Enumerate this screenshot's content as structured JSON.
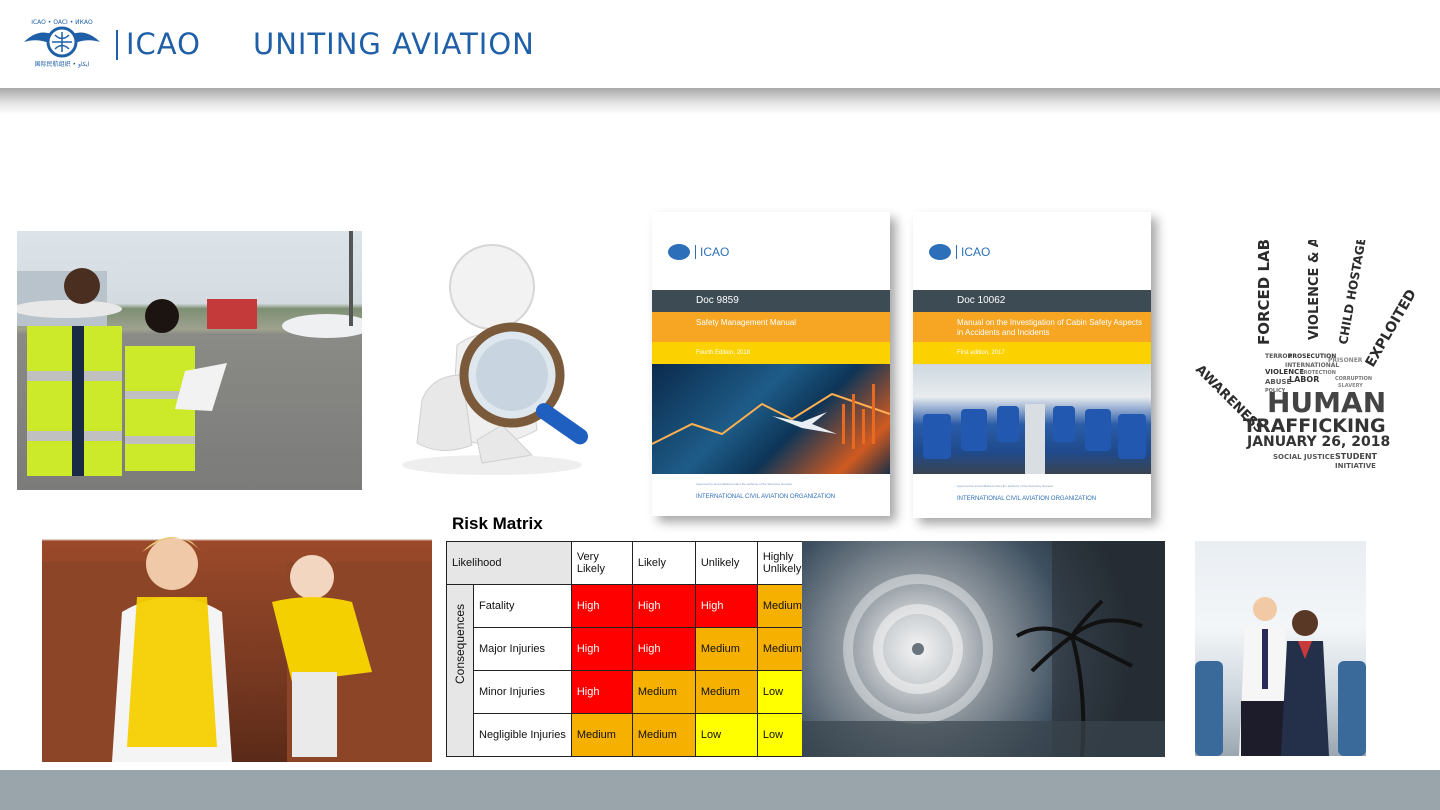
{
  "header": {
    "brand": "ICAO",
    "tagline": "UNITING AVIATION"
  },
  "colors": {
    "brand_blue": "#1f5fa8",
    "risk_high": "#ff0000",
    "risk_medium": "#f6b000",
    "risk_low": "#ffff00",
    "footer": "#9aa5ab"
  },
  "documents": [
    {
      "logo": "ICAO",
      "number": "Doc 9859",
      "title": "Safety Management Manual",
      "edition": "Fourth Edition, 2018",
      "note": "Approved by and published under the authority of the Secretary General",
      "publisher": "INTERNATIONAL CIVIL AVIATION ORGANIZATION"
    },
    {
      "logo": "ICAO",
      "number": "Doc 10062",
      "title": "Manual on the Investigation of Cabin Safety Aspects in Accidents and Incidents",
      "edition": "First edition, 2017",
      "note": "Approved by and published under the authority of the Secretary General",
      "publisher": "INTERNATIONAL CIVIL AVIATION ORGANIZATION"
    }
  ],
  "trafficking_poster": {
    "words_arc": [
      "AWARENESS",
      "FORCED LABOR",
      "VIOLENCE & ABUSE",
      "CHILD HOSTAGE",
      "EXPLOITED"
    ],
    "small_words": [
      "TERROR",
      "PROSECUTION",
      "PRISONER",
      "INTERNATIONAL",
      "VIOLENCE",
      "PROTECTION",
      "ABUSE",
      "LABOR",
      "CORRUPTION",
      "POLICY",
      "SLAVERY"
    ],
    "title_line1": "HUMAN",
    "title_line2": "TRAFFICKING",
    "date": "JANUARY 26, 2018",
    "footer_words": [
      "SOCIAL JUSTICE",
      "STUDENT",
      "INITIATIVE"
    ]
  },
  "risk_matrix": {
    "title": "Risk Matrix",
    "likelihood_label": "Likelihood",
    "consequences_label": "Consequences",
    "columns": [
      "Very Likely",
      "Likely",
      "Unlikely",
      "Highly Unlikely"
    ],
    "rows": [
      {
        "label": "Fatality",
        "cells": [
          "High",
          "High",
          "High",
          "Medium"
        ]
      },
      {
        "label": "Major Injuries",
        "cells": [
          "High",
          "High",
          "Medium",
          "Medium"
        ]
      },
      {
        "label": "Minor Injuries",
        "cells": [
          "High",
          "Medium",
          "Medium",
          "Low"
        ]
      },
      {
        "label": "Negligible Injuries",
        "cells": [
          "Medium",
          "Medium",
          "Low",
          "Low"
        ]
      }
    ]
  }
}
